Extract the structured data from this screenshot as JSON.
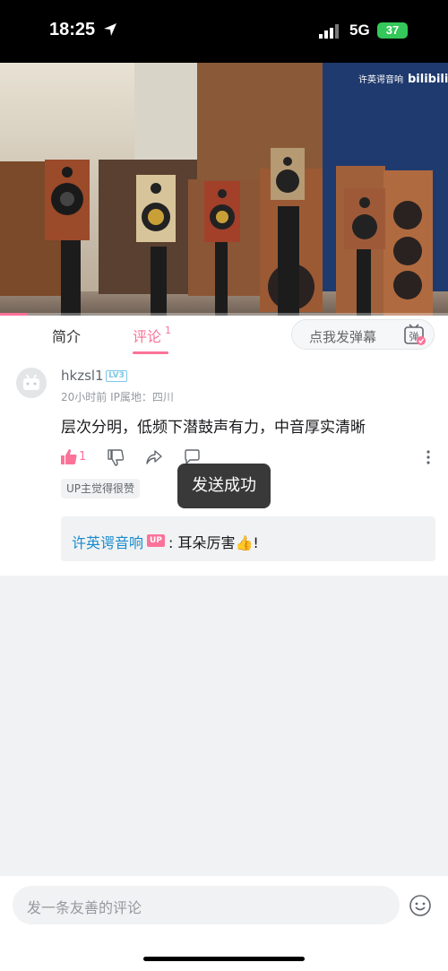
{
  "status_bar": {
    "time": "18:25",
    "network": "5G",
    "battery": "37"
  },
  "video": {
    "brand_text": "许英谔音响 bilibili",
    "progress": 0.06
  },
  "tabs": {
    "intro_label": "简介",
    "comment_label": "评论",
    "comment_count": "1",
    "danmaku_placeholder": "点我发弹幕",
    "danmaku_icon_label": "弹"
  },
  "comment": {
    "username": "hkzsl1",
    "level": "LV3",
    "time_location": "20小时前  IP属地：四川",
    "text": "层次分明，低频下潜鼓声有力，中音厚实清晰",
    "like_count": "1",
    "up_liked_label": "UP主觉得很赞",
    "reply": {
      "user": "许英谔音响",
      "badge": "UP",
      "text": ": 耳朵厉害👍!"
    }
  },
  "toast": {
    "text": "发送成功"
  },
  "bottom_bar": {
    "input_placeholder": "发一条友善的评论"
  },
  "colors": {
    "accent": "#fb7299",
    "link": "#178bcf",
    "battery": "#34c759"
  }
}
